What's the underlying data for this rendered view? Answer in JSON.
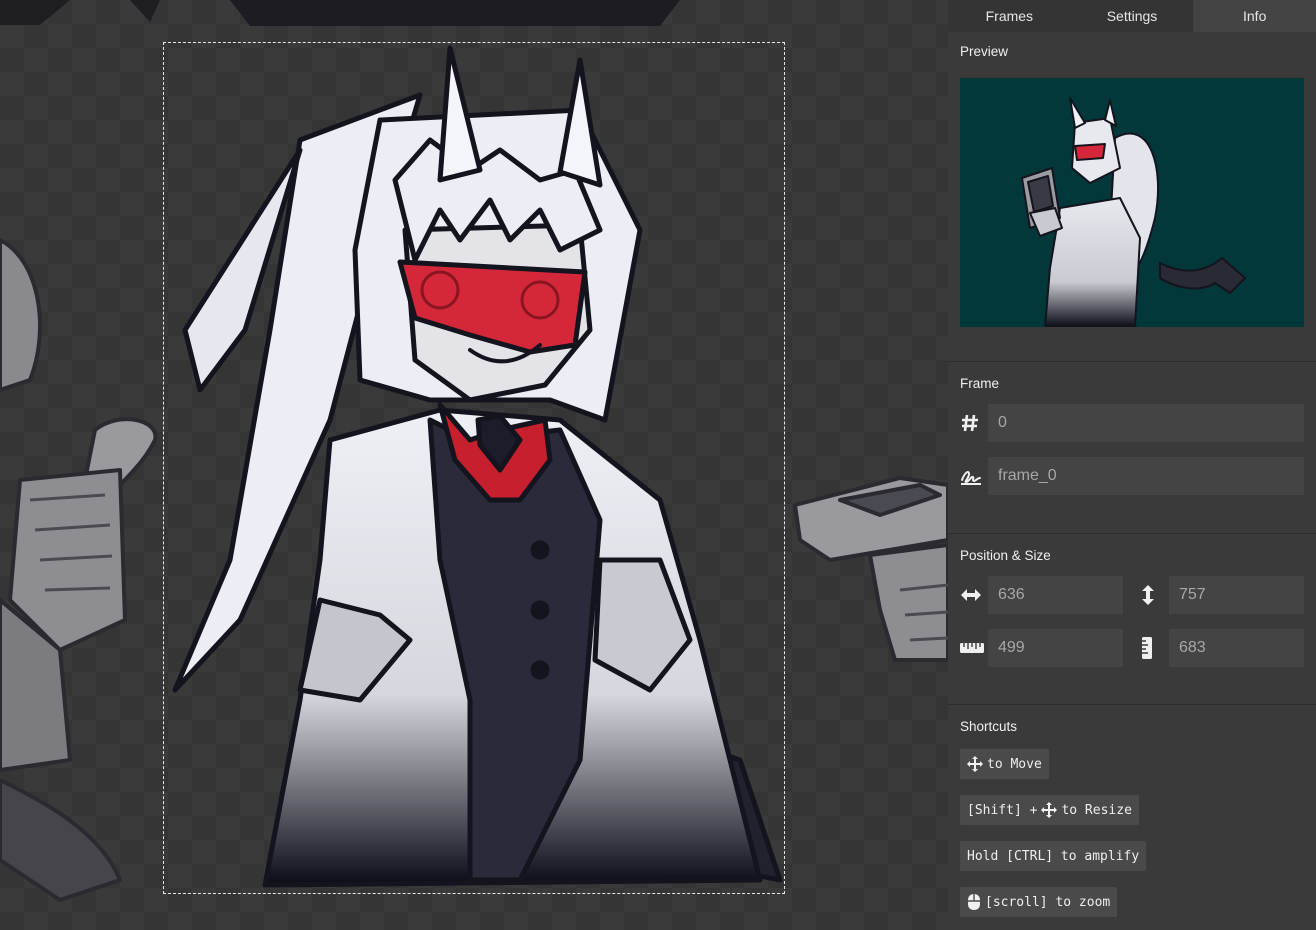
{
  "tabs": [
    {
      "label": "Frames",
      "active": false
    },
    {
      "label": "Settings",
      "active": false
    },
    {
      "label": "Info",
      "active": true
    }
  ],
  "preview": {
    "title": "Preview",
    "background": "#03383a"
  },
  "frame": {
    "title": "Frame",
    "index_value": "0",
    "name_value": "frame_0",
    "index_icon": "hash-icon",
    "name_icon": "signature-icon"
  },
  "position_size": {
    "title": "Position & Size",
    "x": "636",
    "y": "757",
    "width": "499",
    "height": "683",
    "icons": [
      "horizontal-arrows-icon",
      "vertical-arrows-icon",
      "ruler-horizontal-icon",
      "ruler-vertical-icon"
    ]
  },
  "shortcuts": {
    "title": "Shortcuts",
    "move": {
      "icon": "move-arrows-icon",
      "text": "to Move"
    },
    "resize": {
      "prefix": "[Shift] +",
      "icon": "move-arrows-icon",
      "text": "to Resize"
    },
    "amplify": {
      "text": "Hold [CTRL] to amplify"
    },
    "zoom": {
      "icon": "mouse-icon",
      "text": "[scroll] to zoom"
    }
  },
  "colors": {
    "panel_bg": "#3a3a3a",
    "field_bg": "#444444",
    "canvas_bg": "#353535",
    "accent_red": "#d42a3a"
  }
}
